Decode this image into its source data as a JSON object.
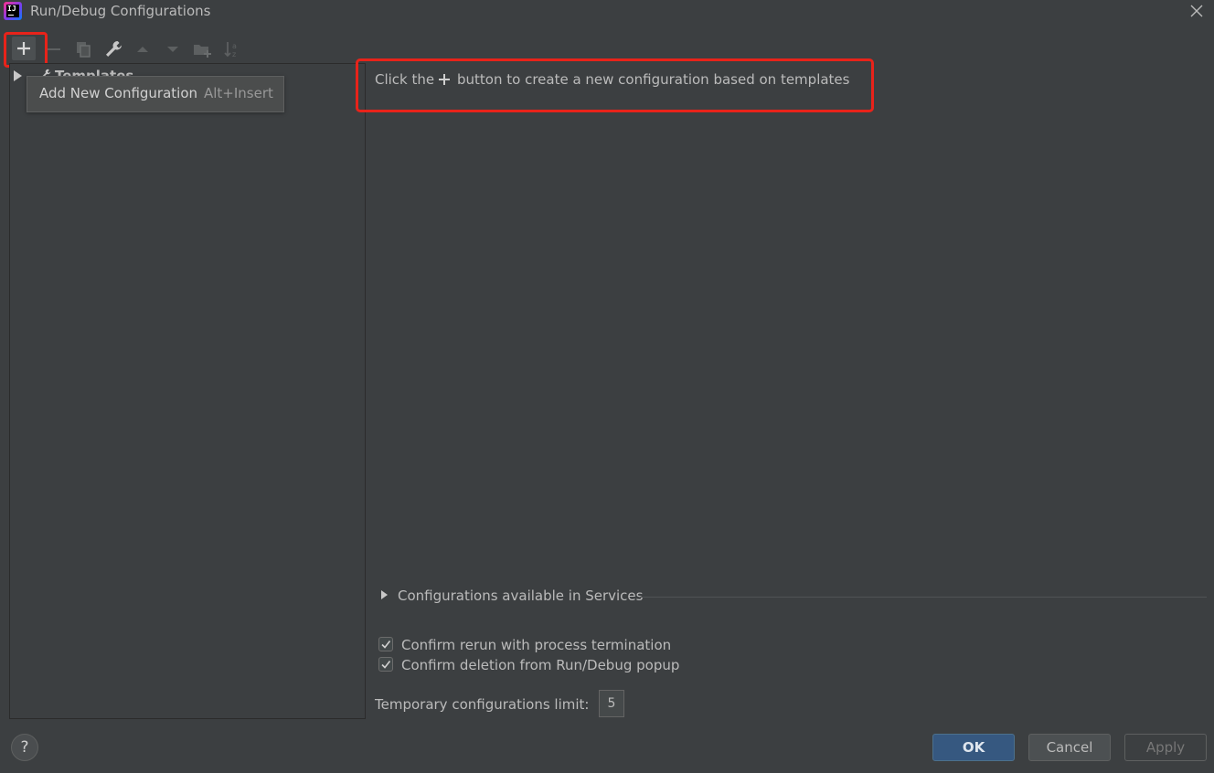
{
  "window": {
    "title": "Run/Debug Configurations",
    "app_icon_text": "IJ"
  },
  "toolbar": {
    "buttons": [
      {
        "name": "add",
        "icon": "plus-icon",
        "enabled": true
      },
      {
        "name": "remove",
        "icon": "minus-icon",
        "enabled": false
      },
      {
        "name": "copy",
        "icon": "copy-icon",
        "enabled": false
      },
      {
        "name": "edit-templates",
        "icon": "wrench-icon",
        "enabled": true
      },
      {
        "name": "move-up",
        "icon": "arrow-up-icon",
        "enabled": false
      },
      {
        "name": "move-down",
        "icon": "arrow-down-icon",
        "enabled": false
      },
      {
        "name": "new-folder",
        "icon": "new-folder-icon",
        "enabled": false
      },
      {
        "name": "sort",
        "icon": "sort-alpha-icon",
        "enabled": false
      }
    ]
  },
  "tree": {
    "items": [
      {
        "label": "Templates",
        "icon": "wrench-icon",
        "expanded": false
      }
    ]
  },
  "tooltip": {
    "label": "Add New Configuration",
    "shortcut": "Alt+Insert"
  },
  "hint": {
    "pre": "Click the",
    "post": "button to create a new configuration based on templates",
    "icon": "plus-icon"
  },
  "services": {
    "label": "Configurations available in Services",
    "expanded": false
  },
  "options": {
    "confirm_rerun": {
      "label": "Confirm rerun with process termination",
      "checked": true
    },
    "confirm_deletion": {
      "label": "Confirm deletion from Run/Debug popup",
      "checked": true
    }
  },
  "temp_limit": {
    "label": "Temporary configurations limit:",
    "value": "5"
  },
  "buttons": {
    "help": "?",
    "ok": "OK",
    "cancel": "Cancel",
    "apply": "Apply"
  },
  "colors": {
    "background": "#3c3f41",
    "highlight": "#e8231a",
    "primary": "#365880",
    "text": "#bbbbbb"
  }
}
